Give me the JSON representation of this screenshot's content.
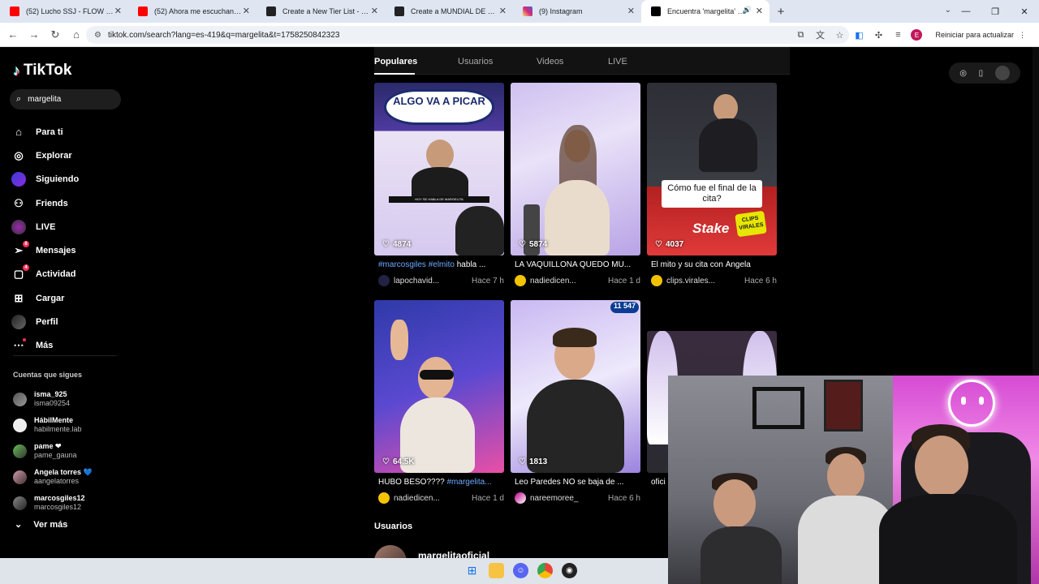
{
  "browser": {
    "tabs": [
      {
        "label": "(52) Lucho SSJ - FLOW HP (VIDEO",
        "favicon_color": "#ff0000",
        "active": false
      },
      {
        "label": "(52) Ahora me escuchan mejor",
        "favicon_color": "#ff0000",
        "active": false
      },
      {
        "label": "Create a New Tier List - TierMaker",
        "favicon_color": "#222222",
        "active": false
      },
      {
        "label": "Create a MUNDIAL DE LA BURG",
        "favicon_color": "#222222",
        "active": false
      },
      {
        "label": "(9) Instagram",
        "favicon_color": "#d62976",
        "active": false
      },
      {
        "label": "Encuentra 'margelita' en TikTok",
        "favicon_color": "#000000",
        "active": true
      }
    ],
    "url": "tiktok.com/search?lang=es-419&q=margelita&t=1758250842323",
    "profile_initial": "E",
    "reload_label": "Reiniciar para actualizar"
  },
  "sidebar": {
    "logo_text": "TikTok",
    "search_value": "margelita",
    "nav": [
      {
        "label": "Para ti",
        "icon": "home-icon"
      },
      {
        "label": "Explorar",
        "icon": "compass-icon"
      },
      {
        "label": "Siguiendo",
        "icon": "avatar"
      },
      {
        "label": "Friends",
        "icon": "friends-icon"
      },
      {
        "label": "LIVE",
        "icon": "live-icon"
      },
      {
        "label": "Mensajes",
        "icon": "messages-icon",
        "badge": "8"
      },
      {
        "label": "Actividad",
        "icon": "activity-icon",
        "badge": "4"
      },
      {
        "label": "Cargar",
        "icon": "upload-icon"
      },
      {
        "label": "Perfil",
        "icon": "profile-avatar"
      },
      {
        "label": "Más",
        "icon": "more-icon"
      }
    ],
    "following_title": "Cuentas que sigues",
    "following": [
      {
        "name": "isma_925",
        "user": "isma09254"
      },
      {
        "name": "HábilMente",
        "user": "habilmente.lab"
      },
      {
        "name": "pame ❤",
        "user": "pame_gauna"
      },
      {
        "name": "Angela torres 💙",
        "user": "aangelatorres"
      },
      {
        "name": "marcosgiles12",
        "user": "marcosgiles12"
      }
    ],
    "see_more": "Ver más"
  },
  "search_tabs": [
    "Populares",
    "Usuarios",
    "Videos",
    "LIVE"
  ],
  "videos": [
    {
      "likes": "4874",
      "caption_tags": "#marcosgiles #elmito",
      "caption_rest": " habla ...",
      "user": "lapochavid...",
      "time": "Hace 7 h"
    },
    {
      "likes": "5874",
      "caption_tags": "",
      "caption_rest": "LA VAQUILLONA QUEDÓ MU...",
      "user": "nadiedicen...",
      "time": "Hace 1 d"
    },
    {
      "likes": "4037",
      "caption_tags": "",
      "caption_rest": "El mito y su cita con Ángela",
      "user": "clips.virales...",
      "time": "Hace 6 h"
    },
    {
      "likes": "64.5K",
      "caption_pre": "HUBO BESO???? ",
      "caption_tags": "#margelita...",
      "user": "nadiedicen...",
      "time": "Hace 1 d"
    },
    {
      "likes": "1813",
      "caption_tags": "",
      "caption_rest": "Leo Paredes NO se baja de ...",
      "user": "nareemoree_",
      "time": "Hace 6 h"
    },
    {
      "likes": "",
      "caption_tags": "",
      "caption_rest": "ofici",
      "user": "",
      "time": ""
    }
  ],
  "thumb_texts": {
    "banner": "ALGO VA A PICAR",
    "strip": "HOY SE HABLA DE MARGELITA",
    "question": "Cómo fue el final de la cita?",
    "stake": "Stake",
    "clips": "CLIPS VIRALES",
    "counter": "11 547"
  },
  "users_title": "Usuarios",
  "user_result": "margelitaoficial"
}
